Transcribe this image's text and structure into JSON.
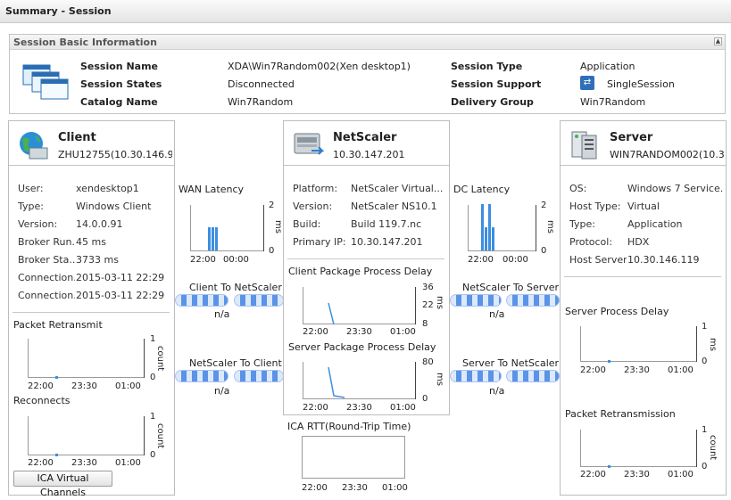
{
  "header": {
    "title": "Summary  - Session"
  },
  "basic_info": {
    "title": "Session Basic Information",
    "collapse_icon": "chevron-up-icon",
    "session_name_label": "Session Name",
    "session_name": "XDA\\Win7Random002(Xen desktop1)",
    "session_states_label": "Session States",
    "session_states": "Disconnected",
    "catalog_name_label": "Catalog Name",
    "catalog_name": "Win7Random",
    "session_type_label": "Session Type",
    "session_type": "Application",
    "session_support_label": "Session Support",
    "session_support": "SingleSession",
    "delivery_group_label": "Delivery Group",
    "delivery_group": "Win7Random"
  },
  "client": {
    "title": "Client",
    "subtitle": "ZHU12755(10.30.146.9...",
    "fields": [
      {
        "k": "User:",
        "v": "xendesktop1"
      },
      {
        "k": "Type:",
        "v": "Windows Client"
      },
      {
        "k": "Version:",
        "v": "14.0.0.91"
      },
      {
        "k": "Broker Run...",
        "v": "45 ms"
      },
      {
        "k": "Broker Sta...",
        "v": "3733 ms"
      },
      {
        "k": "Connection...",
        "v": "2015-03-11 22:29"
      },
      {
        "k": "Connection...",
        "v": "2015-03-11 22:29"
      }
    ],
    "packet_retransmit": {
      "title": "Packet Retransmit",
      "y_max": "1",
      "y_min": "0",
      "unit": "count",
      "x_ticks": [
        "22:00",
        "23:30",
        "01:00"
      ]
    },
    "reconnects": {
      "title": "Reconnects",
      "y_max": "1",
      "y_min": "0",
      "unit": "count",
      "x_ticks": [
        "22:00",
        "23:30",
        "01:00"
      ]
    },
    "ica_button": "ICA Virtual Channels"
  },
  "wan_latency": {
    "title": "WAN Latency",
    "y_max": "2",
    "y_min": "0",
    "unit": "ms",
    "x_ticks": [
      "22:00",
      "00:00"
    ]
  },
  "dc_latency": {
    "title": "DC Latency",
    "y_max": "2",
    "y_min": "0",
    "unit": "ms",
    "x_ticks": [
      "22:00",
      "00:00"
    ]
  },
  "flows": {
    "client_to_ns": "Client To NetScaler",
    "ns_to_client": "NetScaler To Client",
    "ns_to_server": "NetScaler To Server",
    "server_to_ns": "Server To NetScaler",
    "na": "n/a"
  },
  "netscaler": {
    "title": "NetScaler",
    "subtitle": "10.30.147.201",
    "fields": [
      {
        "k": "Platform:",
        "v": "NetScaler Virtual..."
      },
      {
        "k": "Version:",
        "v": "NetScaler NS10.1"
      },
      {
        "k": "Build:",
        "v": "Build 119.7.nc"
      },
      {
        "k": "Primary IP:",
        "v": "10.30.147.201"
      }
    ],
    "client_pkg": {
      "title": "Client Package Process Delay",
      "ticks": [
        "36",
        "22",
        "8"
      ],
      "unit": "ms",
      "x_ticks": [
        "22:00",
        "23:30",
        "01:00"
      ]
    },
    "server_pkg": {
      "title": "Server Package Process Delay",
      "ticks": [
        "80",
        "0"
      ],
      "unit": "ms",
      "x_ticks": [
        "22:00",
        "23:30",
        "01:00"
      ]
    }
  },
  "ica_rtt": {
    "title": "ICA RTT(Round-Trip Time)",
    "x_ticks": [
      "22:00",
      "23:30",
      "01:00"
    ]
  },
  "server": {
    "title": "Server",
    "subtitle": "WIN7RANDOM002(10.30....",
    "fields": [
      {
        "k": "OS:",
        "v": "Windows 7 Service..."
      },
      {
        "k": "Host Type:",
        "v": "Virtual"
      },
      {
        "k": "Type:",
        "v": "Application"
      },
      {
        "k": "Protocol:",
        "v": "HDX"
      },
      {
        "k": "Host Server:",
        "v": "10.30.146.119"
      }
    ],
    "process_delay": {
      "title": "Server Process Delay",
      "y_max": "1",
      "y_min": "0",
      "unit": "ms",
      "x_ticks": [
        "22:00",
        "23:30",
        "01:00"
      ]
    },
    "packet_retransmission": {
      "title": "Packet Retransmission",
      "y_max": "1",
      "y_min": "0",
      "unit": "count",
      "x_ticks": [
        "22:00",
        "23:30",
        "01:00"
      ]
    }
  },
  "colors": {
    "accent": "#3c8ee0",
    "pipe": "#5b93e6"
  }
}
